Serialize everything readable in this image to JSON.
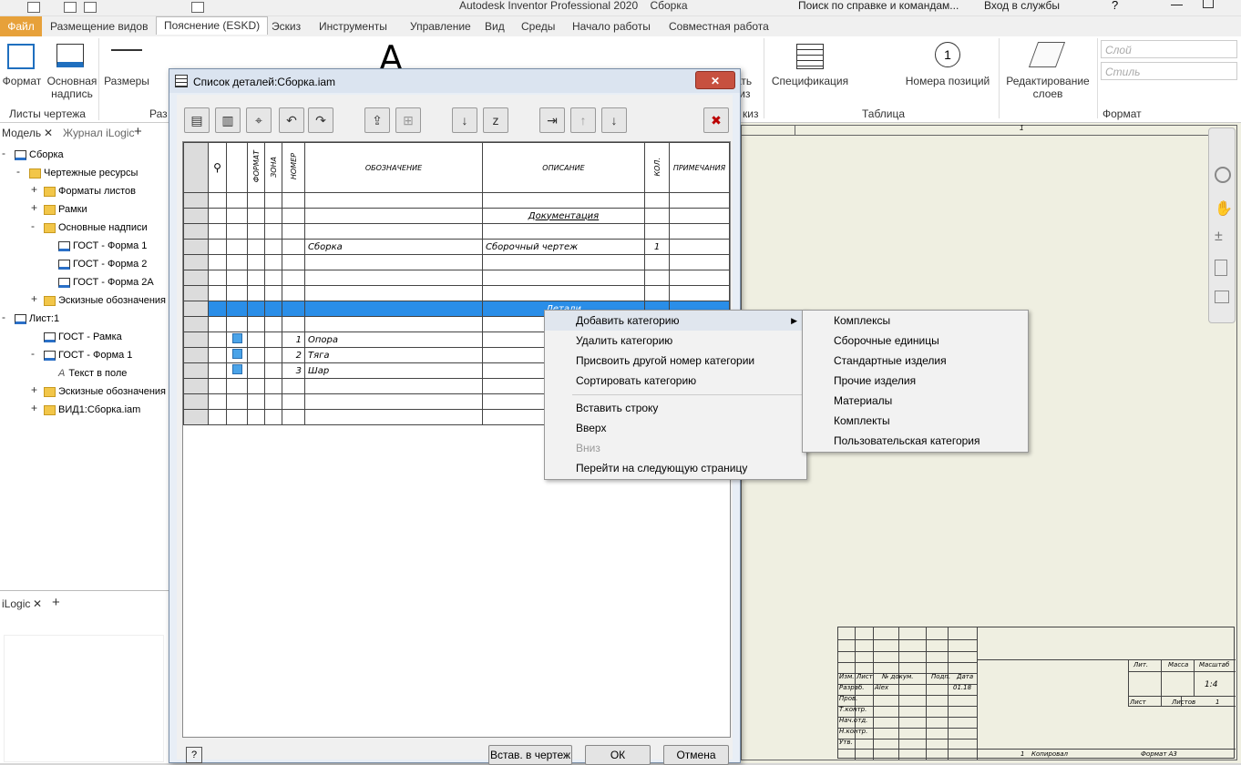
{
  "app": {
    "title": "Autodesk Inventor Professional 2020",
    "doc": "Сборка",
    "search_placeholder": "Поиск по справке и командам...",
    "login": "Вход в службы"
  },
  "tabs": [
    "Файл",
    "Размещение видов",
    "Пояснение (ESKD)",
    "Эскиз",
    "Инструменты",
    "Управление",
    "Вид",
    "Среды",
    "Начало работы",
    "Совместная работа"
  ],
  "ribbon": {
    "format": "Формат",
    "title_block": "Основная надпись",
    "dims": "Размеры",
    "group_sheets": "Листы чертежа",
    "group_dims": "Раз",
    "specs": "Спецификация",
    "item_numbers": "Номера позиций",
    "table_group": "Таблица",
    "edit_layers": "Редактирование слоев",
    "format_group": "Формат",
    "layer_ph": "Слой",
    "style_ph": "Стиль",
    "sketch_partial": "дать скиз",
    "sketch_group": "киз"
  },
  "browser": {
    "tab_model": "Модель",
    "tab_ilogic_journal": "Журнал iLogic",
    "tab_ilogic": "iLogic",
    "items": [
      "Сборка",
      "Чертежные ресурсы",
      "Форматы листов",
      "Рамки",
      "Основные надписи",
      "ГОСТ - Форма 1",
      "ГОСТ - Форма 2",
      "ГОСТ - Форма 2А",
      "Эскизные обозначения",
      "Лист:1",
      "ГОСТ - Рамка",
      "ГОСТ - Форма 1",
      "Текст в поле",
      "Эскизные обозначения",
      "ВИД1:Сборка.iam"
    ]
  },
  "dialog": {
    "title": "Список деталей:Сборка.iam",
    "insert_btn": "Встав. в чертеж",
    "ok": "ОК",
    "cancel": "Отмена",
    "headers": {
      "format": "ФОРМАТ",
      "zone": "ЗОНА",
      "number": "НОМЕР",
      "designation": "ОБОЗНАЧЕНИЕ",
      "description": "ОПИСАНИЕ",
      "qty": "КОЛ.",
      "notes": "ПРИМЕЧАНИЯ"
    },
    "rows": [
      {
        "num": "",
        "des": "",
        "desc": "",
        "qty": ""
      },
      {
        "num": "",
        "des": "",
        "desc": "Документация",
        "qty": ""
      },
      {
        "num": "",
        "des": "",
        "desc": "",
        "qty": ""
      },
      {
        "num": "",
        "des": "Сборка",
        "desc": "Сборочный чертеж",
        "qty": "1"
      },
      {
        "num": "",
        "des": "",
        "desc": "",
        "qty": ""
      },
      {
        "num": "",
        "des": "",
        "desc": "",
        "qty": ""
      },
      {
        "num": "",
        "des": "",
        "desc": "",
        "qty": ""
      },
      {
        "num": "",
        "des": "",
        "desc": "Детали",
        "qty": ""
      },
      {
        "num": "",
        "des": "",
        "desc": "",
        "qty": ""
      },
      {
        "num": "1",
        "des": "Опора",
        "desc": "",
        "qty": ""
      },
      {
        "num": "2",
        "des": "Тяга",
        "desc": "",
        "qty": ""
      },
      {
        "num": "3",
        "des": "Шар",
        "desc": "",
        "qty": ""
      },
      {
        "num": "",
        "des": "",
        "desc": "",
        "qty": ""
      },
      {
        "num": "",
        "des": "",
        "desc": "",
        "qty": ""
      },
      {
        "num": "",
        "des": "",
        "desc": "",
        "qty": ""
      }
    ]
  },
  "context_menu": [
    "Добавить категорию",
    "Удалить категорию",
    "Присвоить другой номер категории",
    "Сортировать категорию",
    "Вставить строку",
    "Вверх",
    "Вниз",
    "Перейти на следующую страницу"
  ],
  "submenu": [
    "Комплексы",
    "Сборочные единицы",
    "Стандартные изделия",
    "Прочие изделия",
    "Материалы",
    "Комплекты",
    "Пользовательская категория"
  ],
  "title_block": {
    "lit": "Лит.",
    "mass": "Масса",
    "scale": "Масштаб",
    "scale_val": "1:4",
    "sheet": "Лист",
    "sheets": "Листов",
    "sheets_val": "1",
    "izm": "Изм.",
    "list": "Лист",
    "doc_no": "№ докум.",
    "sign": "Подп.",
    "date": "Дата",
    "razrab": "Разраб.",
    "author": "Alex",
    "date_val": "01.18",
    "prov": "Пров.",
    "tkontr": "Т.контр.",
    "nach": "Нач.отд.",
    "nkontr": "Н.контр.",
    "utv": "Утв.",
    "copied": "Копировал",
    "format": "Формат A3",
    "top_num": "1",
    "bottom_num": "1"
  }
}
